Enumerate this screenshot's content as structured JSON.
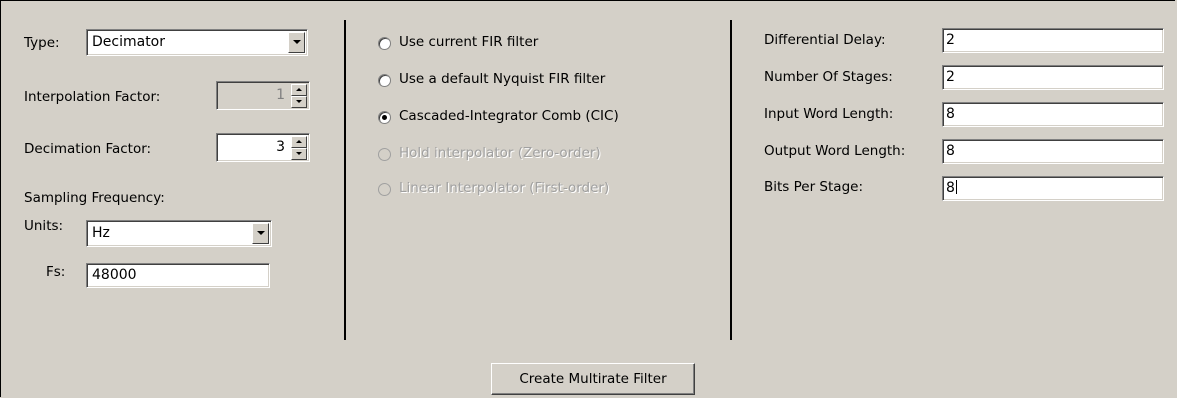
{
  "left_panel": {
    "type_label": "Type:",
    "type_value": "Decimator",
    "interpolation_label": "Interpolation Factor:",
    "interpolation_value": "1",
    "decimation_label": "Decimation Factor:",
    "decimation_value": "3",
    "sampling_label": "Sampling Frequency:",
    "units_label": "Units:",
    "units_value": "Hz",
    "fs_label": "Fs:",
    "fs_value": "48000"
  },
  "middle_panel": {
    "options": [
      {
        "label": "Use current FIR filter",
        "selected": false,
        "enabled": true
      },
      {
        "label": "Use a default Nyquist FIR filter",
        "selected": false,
        "enabled": true
      },
      {
        "label": "Cascaded-Integrator Comb (CIC)",
        "selected": true,
        "enabled": true
      },
      {
        "label": "Hold interpolator (Zero-order)",
        "selected": false,
        "enabled": false
      },
      {
        "label": "Linear Interpolator (First-order)",
        "selected": false,
        "enabled": false
      }
    ]
  },
  "right_panel": {
    "fields": [
      {
        "label": "Differential Delay:",
        "value": "2"
      },
      {
        "label": "Number Of Stages:",
        "value": "2"
      },
      {
        "label": "Input Word Length:",
        "value": "8"
      },
      {
        "label": "Output Word Length:",
        "value": "8"
      },
      {
        "label": "Bits Per Stage:",
        "value": "8"
      }
    ]
  },
  "footer": {
    "create_button": "Create Multirate Filter"
  }
}
